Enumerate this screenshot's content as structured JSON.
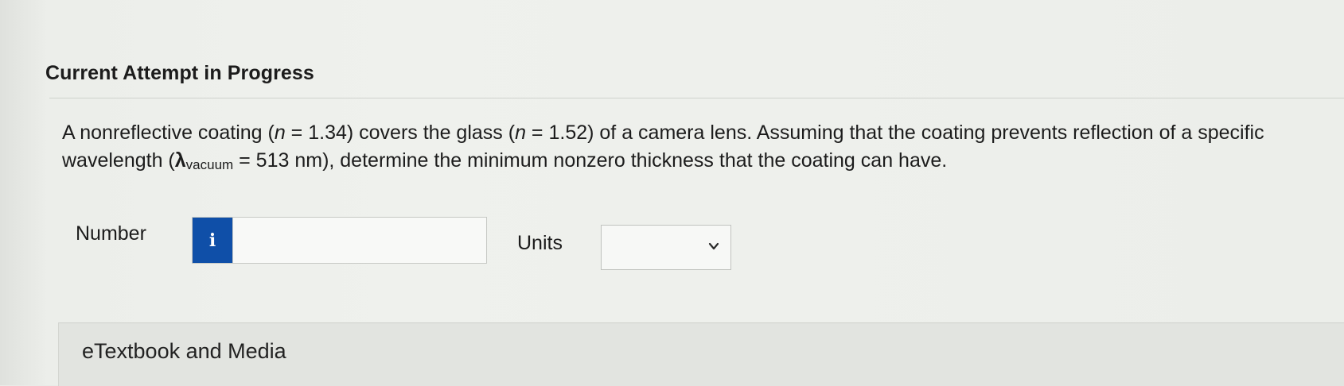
{
  "header": {
    "attempt_title": "Current Attempt in Progress"
  },
  "question": {
    "part1": "A nonreflective coating (",
    "n1_var": "n",
    "part2": " = 1.34) covers the glass (",
    "n2_var": "n",
    "part3": " = 1.52) of a camera lens. Assuming that the coating prevents reflection of a specific wavelength (",
    "lambda_symbol": "λ",
    "lambda_sub": "vacuum",
    "part4": " = 513 nm), determine the minimum nonzero thickness that the coating can have."
  },
  "answer": {
    "number_label": "Number",
    "info_icon_glyph": "i",
    "number_value": "",
    "units_label": "Units",
    "units_value": ""
  },
  "resources": {
    "etextbook_label": "eTextbook and Media"
  },
  "colors": {
    "info_button": "#0f4fa8",
    "background": "#eceeea"
  }
}
